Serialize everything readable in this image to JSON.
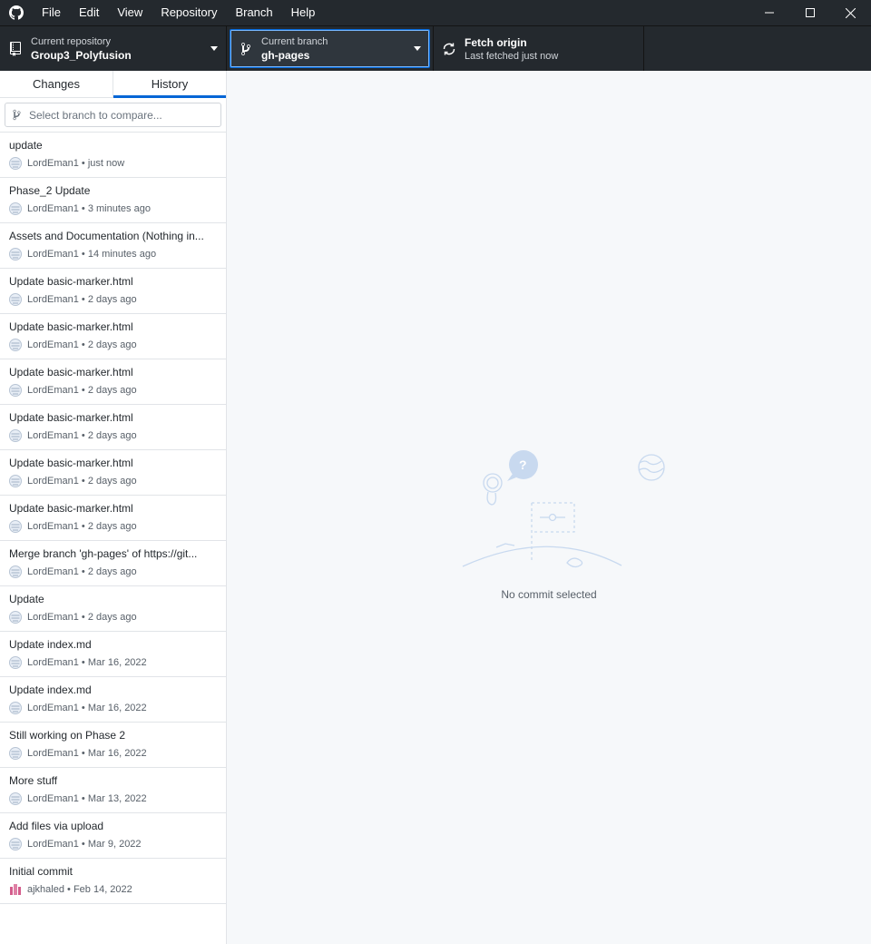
{
  "menu": [
    "File",
    "Edit",
    "View",
    "Repository",
    "Branch",
    "Help"
  ],
  "toolbar": {
    "repo_label": "Current repository",
    "repo_value": "Group3_Polyfusion",
    "branch_label": "Current branch",
    "branch_value": "gh-pages",
    "fetch_label": "Fetch origin",
    "fetch_sub": "Last fetched just now"
  },
  "tabs": {
    "changes": "Changes",
    "history": "History"
  },
  "compare": {
    "placeholder": "Select branch to compare..."
  },
  "commits": [
    {
      "title": "update",
      "author": "LordEman1",
      "time": "just now"
    },
    {
      "title": "Phase_2 Update",
      "author": "LordEman1",
      "time": "3 minutes ago"
    },
    {
      "title": "Assets and Documentation (Nothing in...",
      "author": "LordEman1",
      "time": "14 minutes ago"
    },
    {
      "title": "Update basic-marker.html",
      "author": "LordEman1",
      "time": "2 days ago"
    },
    {
      "title": "Update basic-marker.html",
      "author": "LordEman1",
      "time": "2 days ago"
    },
    {
      "title": "Update basic-marker.html",
      "author": "LordEman1",
      "time": "2 days ago"
    },
    {
      "title": "Update basic-marker.html",
      "author": "LordEman1",
      "time": "2 days ago"
    },
    {
      "title": "Update basic-marker.html",
      "author": "LordEman1",
      "time": "2 days ago"
    },
    {
      "title": "Update basic-marker.html",
      "author": "LordEman1",
      "time": "2 days ago"
    },
    {
      "title": "Merge branch 'gh-pages' of https://git...",
      "author": "LordEman1",
      "time": "2 days ago"
    },
    {
      "title": "Update",
      "author": "LordEman1",
      "time": "2 days ago"
    },
    {
      "title": "Update index.md",
      "author": "LordEman1",
      "time": "Mar 16, 2022"
    },
    {
      "title": "Update index.md",
      "author": "LordEman1",
      "time": "Mar 16, 2022"
    },
    {
      "title": "Still working on Phase 2",
      "author": "LordEman1",
      "time": "Mar 16, 2022"
    },
    {
      "title": "More stuff",
      "author": "LordEman1",
      "time": "Mar 13, 2022"
    },
    {
      "title": "Add files via upload",
      "author": "LordEman1",
      "time": "Mar 9, 2022"
    },
    {
      "title": "Initial commit",
      "author": "ajkhaled",
      "time": "Feb 14, 2022",
      "avatar": "ajkhaled"
    }
  ],
  "main": {
    "blank_text": "No commit selected"
  },
  "colors": {
    "accent": "#0366d6",
    "titlebar": "#24292e"
  },
  "icons": [
    "github-icon",
    "minimize-icon",
    "maximize-icon",
    "close-icon",
    "repo-icon",
    "branch-icon",
    "sync-icon",
    "caret-down-icon"
  ]
}
